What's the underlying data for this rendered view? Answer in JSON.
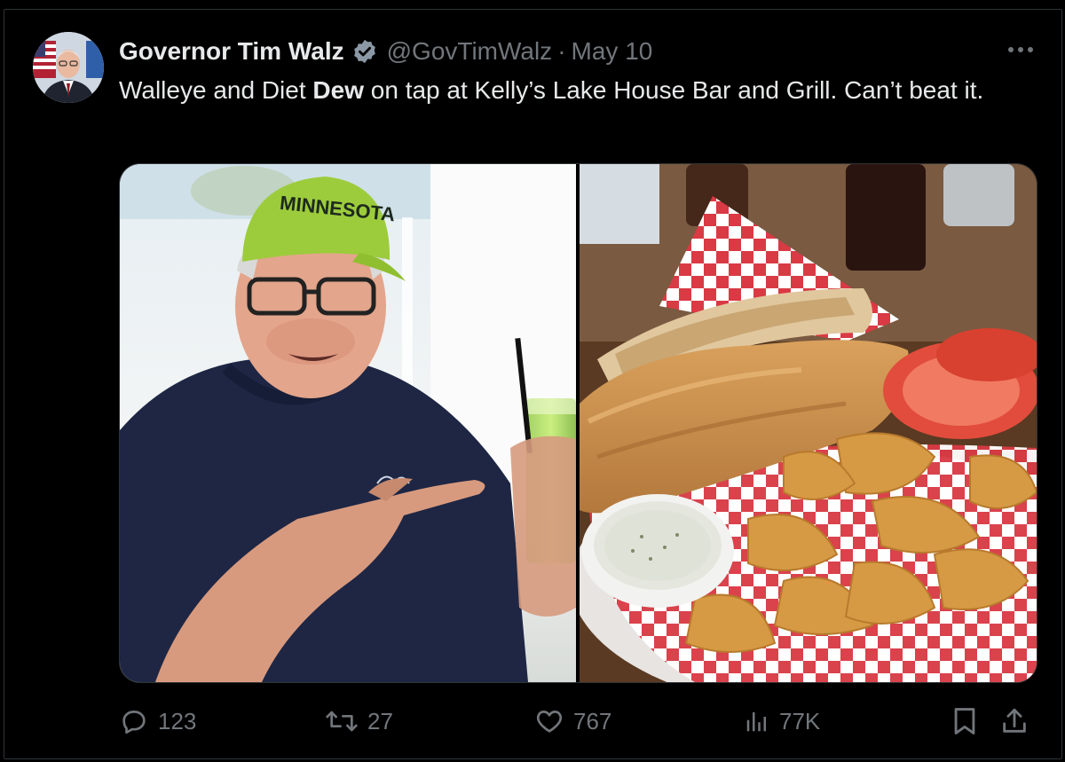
{
  "tweet": {
    "author": {
      "display_name": "Governor Tim Walz",
      "handle": "@GovTimWalz",
      "verified_icon": "verified-badge-icon"
    },
    "separator": "·",
    "date": "May 10",
    "text_parts": {
      "before": "Walleye and Diet ",
      "bold": "Dew",
      "after": " on tap at Kelly’s Lake House Bar and Grill. Can’t beat it."
    },
    "media": [
      {
        "name": "photo-governor-with-drink",
        "cap_text": "MINNESOTA"
      },
      {
        "name": "photo-walleye-sandwich-basket"
      }
    ],
    "actions": {
      "replies": "123",
      "reposts": "27",
      "likes": "767",
      "views": "77K"
    }
  },
  "colors": {
    "background": "#000000",
    "text_primary": "#e7e9ea",
    "text_secondary": "#71767b",
    "border": "#2f3336",
    "verified": "#8b98a5"
  }
}
